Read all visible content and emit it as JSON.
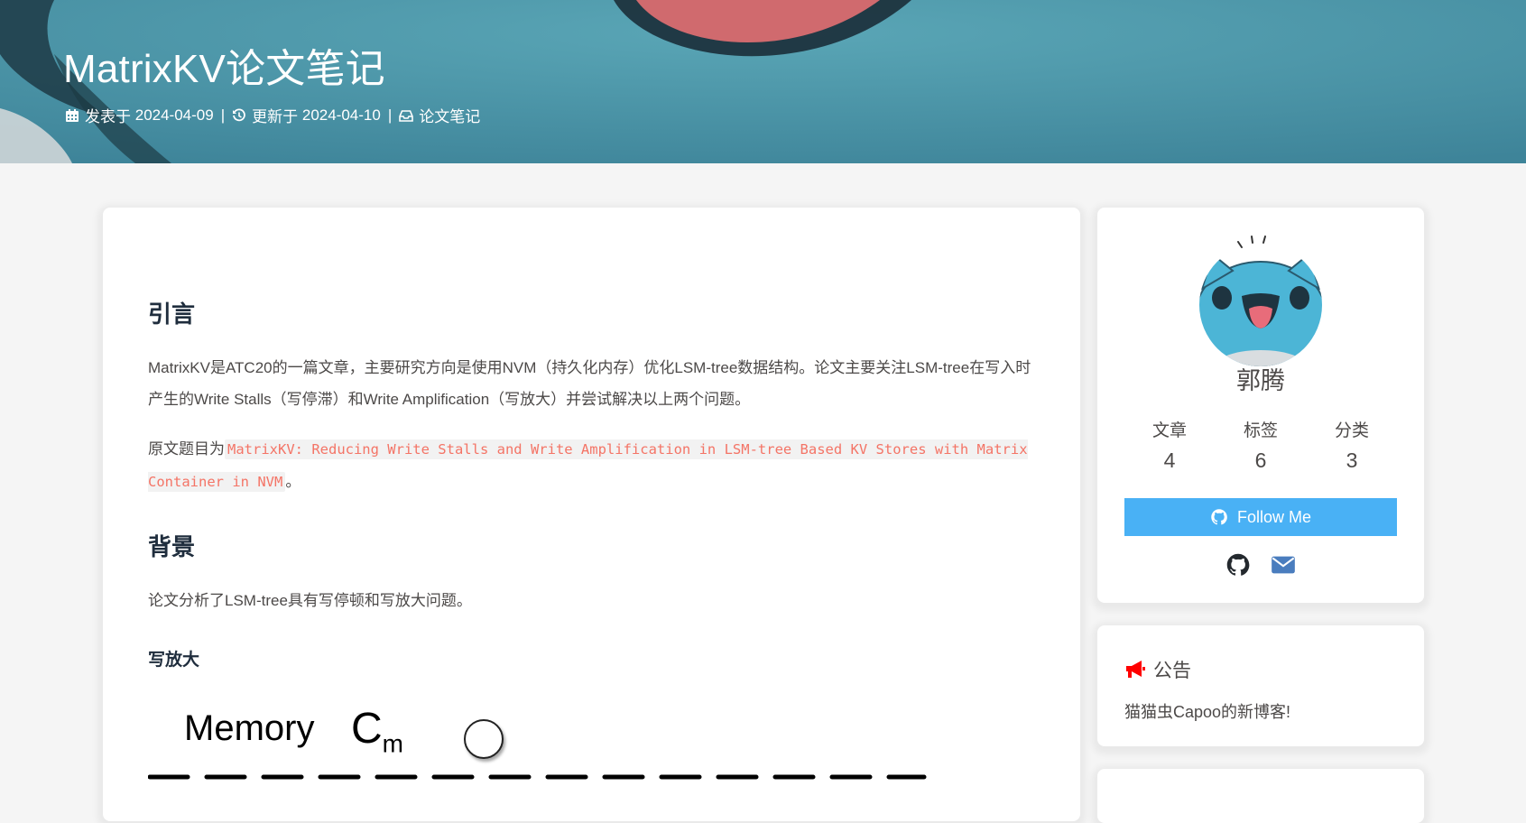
{
  "header": {
    "title": "MatrixKV论文笔记",
    "meta": {
      "published_label": "发表于",
      "published_date": "2024-04-09",
      "updated_label": "更新于",
      "updated_date": "2024-04-10",
      "separator": "|",
      "category": "论文笔记"
    }
  },
  "article": {
    "h_intro": "引言",
    "p_intro": "MatrixKV是ATC20的一篇文章，主要研究方向是使用NVM（持久化内存）优化LSM-tree数据结构。论文主要关注LSM-tree在写入时产生的Write Stalls（写停滞）和Write Amplification（写放大）并尝试解决以上两个问题。",
    "p_title_prefix": "原文题目为",
    "p_title_code": "MatrixKV: Reducing Write Stalls and Write Amplification in LSM-tree Based KV Stores with Matrix Container in NVM",
    "p_title_suffix": "。",
    "h_background": "背景",
    "p_background": "论文分析了LSM-tree具有写停顿和写放大问题。",
    "h_write_amp": "写放大",
    "figure": {
      "memory_label": "Memory",
      "cm_label": "C",
      "cm_sub": "m"
    }
  },
  "author": {
    "name": "郭腾",
    "stats": [
      {
        "label": "文章",
        "value": "4"
      },
      {
        "label": "标签",
        "value": "6"
      },
      {
        "label": "分类",
        "value": "3"
      }
    ],
    "follow_label": "Follow Me"
  },
  "notice": {
    "title": "公告",
    "text": "猫猫虫Capoo的新博客!"
  },
  "icons": {
    "published": "calendar-icon",
    "updated": "history-icon",
    "category": "inbox-icon",
    "follow": "github-icon",
    "social": [
      "github-icon",
      "envelope-icon"
    ],
    "notice": "bullhorn-icon"
  },
  "colors": {
    "accent": "#49b1f5",
    "banner": "#4b93a6",
    "code": "#f47466",
    "notice_icon": "#ff0000",
    "mail_icon": "#4a7dbe"
  }
}
